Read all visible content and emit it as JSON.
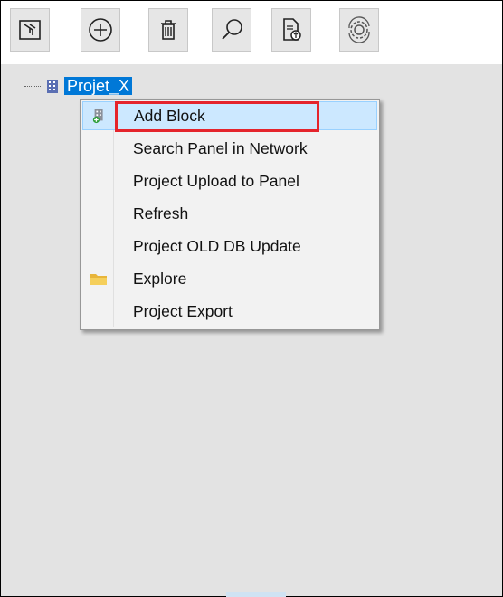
{
  "toolbar": {
    "buttons": [
      {
        "name": "import-button",
        "icon": "import-project-icon"
      },
      {
        "name": "add-button",
        "icon": "add-circle-icon"
      },
      {
        "name": "delete-button",
        "icon": "trash-icon"
      },
      {
        "name": "search-button",
        "icon": "magnifier-icon"
      },
      {
        "name": "upload-button",
        "icon": "document-upload-icon"
      },
      {
        "name": "settings-button",
        "icon": "gear-sync-icon"
      }
    ]
  },
  "tree": {
    "root_label": "Projet_X"
  },
  "context_menu": {
    "items": [
      {
        "label": "Add Block",
        "icon": "add-block-icon",
        "active": true
      },
      {
        "label": "Search Panel in Network"
      },
      {
        "label": "Project Upload to Panel"
      },
      {
        "label": "Refresh"
      },
      {
        "label": "Project OLD DB Update"
      },
      {
        "label": "Explore",
        "icon": "folder-icon"
      },
      {
        "label": "Project Export"
      }
    ]
  },
  "colors": {
    "selection": "#0078d7",
    "menu_highlight": "#cce8ff",
    "annotation_red": "#e5242c"
  }
}
